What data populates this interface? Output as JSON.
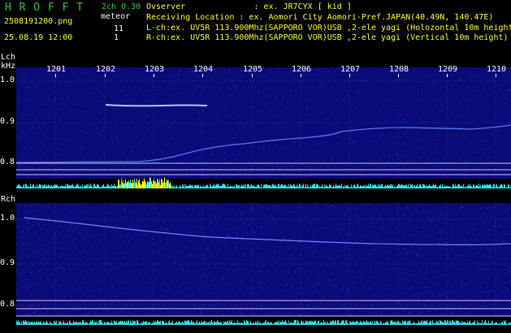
{
  "header": {
    "logo": "H R O F F T",
    "version": "2ch 0.30",
    "filename": "2508191200.png",
    "datetime": "25.08.19 12:00",
    "meteor_label": "meteor",
    "meteor_lch_count": "11",
    "meteor_rch_count": "1",
    "observer_line": "Ovserver              : ex. JR7CYX [ kid ]",
    "location_line": "Receiving Location : ex. Aomori City Aomori-Pref.JAPAN(40.49N, 140.47E)",
    "lch_line": "L-ch:ex. UV5R 113.900Mhz(SAPPORO VOR)USB ,2-ele yagi (Holozontal 10m height)",
    "rch_line": "R-ch:ex. UV5R 113.900Mhz(SAPPORO VOR)USB ,2-ele yagi (Vertical 10m height)"
  },
  "lch_panel": {
    "label": "Lch",
    "unit": "kHz",
    "time_ticks": [
      "1201",
      "1202",
      "1203",
      "1204",
      "1205",
      "1206",
      "1207",
      "1208",
      "1209",
      "1210"
    ],
    "freq_ticks": [
      "1.0",
      "0.9",
      "0.8"
    ]
  },
  "rch_panel": {
    "label": "Rch",
    "freq_ticks": [
      "1.0",
      "0.9",
      "0.8"
    ]
  },
  "colors": {
    "logo_green": "#33cc33",
    "text_yellow": "#ffff33",
    "text_white": "#ffffff",
    "spectrogram_bg": "#0a0a78",
    "signal_cyan": "#33ddee",
    "meteor_yellow": "#ffff00",
    "grid_line": "#ccccff"
  }
}
